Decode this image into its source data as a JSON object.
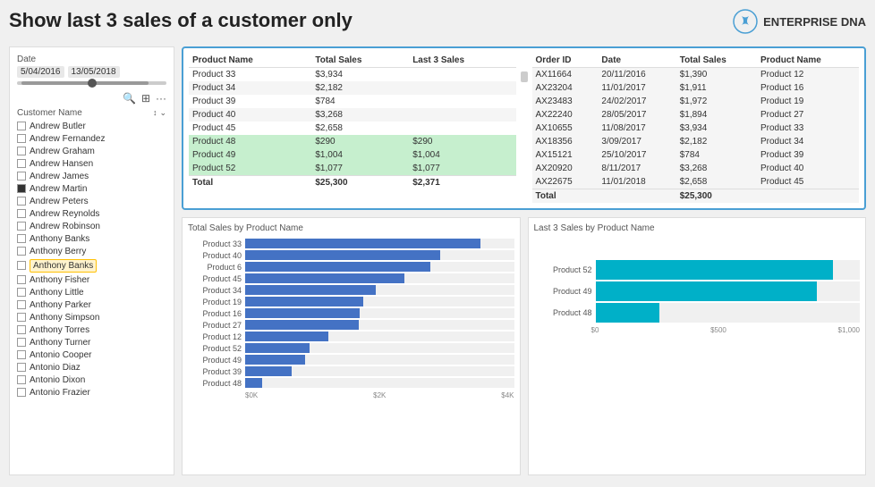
{
  "title": "Show last 3 sales of a customer only",
  "logo": {
    "text": "ENTERPRISE DNA"
  },
  "sidebar": {
    "date_label": "Date",
    "date_start": "5/04/2016",
    "date_end": "13/05/2018",
    "customer_label": "Customer Name",
    "customers": [
      {
        "name": "Andrew Butler",
        "checked": false
      },
      {
        "name": "Andrew Fernandez",
        "checked": false
      },
      {
        "name": "Andrew Graham",
        "checked": false
      },
      {
        "name": "Andrew Hansen",
        "checked": false
      },
      {
        "name": "Andrew James",
        "checked": false
      },
      {
        "name": "Andrew Martin",
        "checked": true
      },
      {
        "name": "Andrew Peters",
        "checked": false
      },
      {
        "name": "Andrew Reynolds",
        "checked": false
      },
      {
        "name": "Andrew Robinson",
        "checked": false
      },
      {
        "name": "Anthony Banks",
        "checked": false,
        "tooltip": true
      },
      {
        "name": "Anthony Berry",
        "checked": false
      },
      {
        "name": "Anthony Banks",
        "checked": false,
        "highlighted": true
      },
      {
        "name": "Anthony Fisher",
        "checked": false
      },
      {
        "name": "Anthony Little",
        "checked": false
      },
      {
        "name": "Anthony Parker",
        "checked": false
      },
      {
        "name": "Anthony Simpson",
        "checked": false
      },
      {
        "name": "Anthony Torres",
        "checked": false
      },
      {
        "name": "Anthony Turner",
        "checked": false
      },
      {
        "name": "Antonio Cooper",
        "checked": false
      },
      {
        "name": "Antonio Diaz",
        "checked": false
      },
      {
        "name": "Antonio Dixon",
        "checked": false
      },
      {
        "name": "Antonio Frazier",
        "checked": false
      }
    ]
  },
  "left_table": {
    "headers": [
      "Product Name",
      "Total Sales",
      "Last 3 Sales"
    ],
    "rows": [
      {
        "product": "Product 33",
        "total": "$3,934",
        "last3": ""
      },
      {
        "product": "Product 34",
        "total": "$2,182",
        "last3": ""
      },
      {
        "product": "Product 39",
        "total": "$784",
        "last3": ""
      },
      {
        "product": "Product 40",
        "total": "$3,268",
        "last3": ""
      },
      {
        "product": "Product 45",
        "total": "$2,658",
        "last3": ""
      },
      {
        "product": "Product 48",
        "total": "$290",
        "last3": "$290",
        "highlight": true
      },
      {
        "product": "Product 49",
        "total": "$1,004",
        "last3": "$1,004",
        "highlight": true
      },
      {
        "product": "Product 52",
        "total": "$1,077",
        "last3": "$1,077",
        "highlight": true
      }
    ],
    "total": {
      "label": "Total",
      "total": "$25,300",
      "last3": "$2,371"
    }
  },
  "right_table": {
    "headers": [
      "Order ID",
      "Date",
      "Total Sales",
      "Product Name"
    ],
    "rows": [
      {
        "order": "AX11664",
        "date": "20/11/2016",
        "total": "$1,390",
        "product": "Product 12"
      },
      {
        "order": "AX23204",
        "date": "11/01/2017",
        "total": "$1,911",
        "product": "Product 16"
      },
      {
        "order": "AX23483",
        "date": "24/02/2017",
        "total": "$1,972",
        "product": "Product 19"
      },
      {
        "order": "AX22240",
        "date": "28/05/2017",
        "total": "$1,894",
        "product": "Product 27"
      },
      {
        "order": "AX10655",
        "date": "11/08/2017",
        "total": "$3,934",
        "product": "Product 33"
      },
      {
        "order": "AX18356",
        "date": "3/09/2017",
        "total": "$2,182",
        "product": "Product 34"
      },
      {
        "order": "AX15121",
        "date": "25/10/2017",
        "total": "$784",
        "product": "Product 39"
      },
      {
        "order": "AX20920",
        "date": "8/11/2017",
        "total": "$3,268",
        "product": "Product 40"
      },
      {
        "order": "AX22675",
        "date": "11/01/2018",
        "total": "$2,658",
        "product": "Product 45"
      }
    ],
    "total": {
      "label": "Total",
      "total": "$25,300"
    }
  },
  "chart_left": {
    "title": "Total Sales by Product Name",
    "bars": [
      {
        "label": "Product 33",
        "value": 3934,
        "max": 4500
      },
      {
        "label": "Product 40",
        "value": 3268,
        "max": 4500
      },
      {
        "label": "Product 6",
        "value": 3100,
        "max": 4500
      },
      {
        "label": "Product 45",
        "value": 2658,
        "max": 4500
      },
      {
        "label": "Product 34",
        "value": 2182,
        "max": 4500
      },
      {
        "label": "Product 19",
        "value": 1972,
        "max": 4500
      },
      {
        "label": "Product 16",
        "value": 1911,
        "max": 4500
      },
      {
        "label": "Product 27",
        "value": 1894,
        "max": 4500
      },
      {
        "label": "Product 12",
        "value": 1390,
        "max": 4500
      },
      {
        "label": "Product 52",
        "value": 1077,
        "max": 4500
      },
      {
        "label": "Product 49",
        "value": 1004,
        "max": 4500
      },
      {
        "label": "Product 39",
        "value": 784,
        "max": 4500
      },
      {
        "label": "Product 48",
        "value": 290,
        "max": 4500
      }
    ],
    "axis": [
      "$0K",
      "$2K",
      "$4K"
    ]
  },
  "chart_right": {
    "title": "Last 3 Sales by Product Name",
    "bars": [
      {
        "label": "Product 52",
        "value": 1077,
        "max": 1200
      },
      {
        "label": "Product 49",
        "value": 1004,
        "max": 1200
      },
      {
        "label": "Product 48",
        "value": 290,
        "max": 1200
      }
    ],
    "axis": [
      "$0",
      "$500",
      "$1,000"
    ]
  }
}
